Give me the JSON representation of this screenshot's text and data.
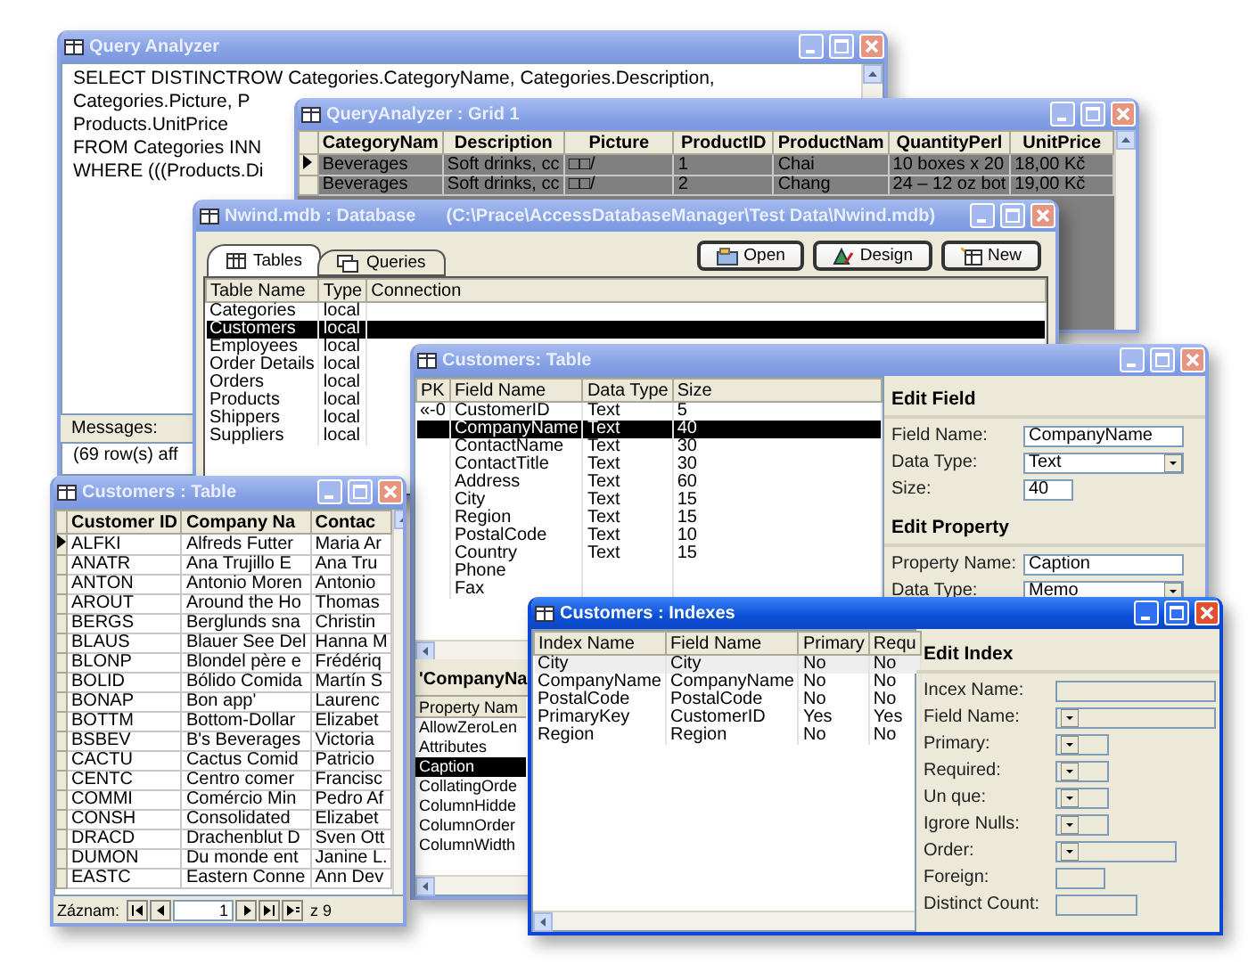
{
  "query_analyzer": {
    "title": "Query Analyzer",
    "active": false,
    "sql_lines": [
      "SELECT DISTINCTROW Categories.CategoryName, Categories.Description,",
      "Categories.Picture, P",
      "Products.UnitPrice",
      "FROM Categories INN",
      "WHERE (((Products.Di"
    ],
    "messages_label": "Messages:",
    "messages": [
      "(69 row(s) aff"
    ]
  },
  "grid": {
    "title": "QueryAnalyzer : Grid 1",
    "active": false,
    "columns": [
      "CategoryNam",
      "Description",
      "Picture",
      "ProductID",
      "ProductNam",
      "QuantityPerl",
      "UnitPrice"
    ],
    "rows": [
      {
        "current": true,
        "cells": [
          "Beverages",
          "Soft drinks, cc",
          "□□/",
          "1",
          "Chai",
          "10 boxes x 20",
          "18,00 Kč"
        ]
      },
      {
        "current": false,
        "cells": [
          "Beverages",
          "Soft drinks, cc",
          "□□/",
          "2",
          "Chang",
          "24 – 12 oz bot",
          "19,00 Kč"
        ]
      }
    ]
  },
  "database": {
    "title": "Nwind.mdb : Database",
    "path": "(C:\\Prace\\AccessDatabaseManager\\Test Data\\Nwind.mdb)",
    "active": false,
    "tabs": [
      {
        "label": "Tables",
        "kind": "tables",
        "selected": true
      },
      {
        "label": "Queries",
        "kind": "queries",
        "selected": false
      }
    ],
    "buttons": [
      {
        "label": "Open",
        "kind": "open"
      },
      {
        "label": "Design",
        "kind": "design"
      },
      {
        "label": "New",
        "kind": "new"
      }
    ],
    "columns": [
      "Table Name",
      "Type",
      "Connection"
    ],
    "rows": [
      {
        "selected": false,
        "cells": [
          "Categories",
          "local"
        ]
      },
      {
        "selected": true,
        "cells": [
          "Customers",
          "local"
        ]
      },
      {
        "selected": false,
        "cells": [
          "Employees",
          "local"
        ]
      },
      {
        "selected": false,
        "cells": [
          "Order Details",
          "local"
        ]
      },
      {
        "selected": false,
        "cells": [
          "Orders",
          "local"
        ]
      },
      {
        "selected": false,
        "cells": [
          "Products",
          "local"
        ]
      },
      {
        "selected": false,
        "cells": [
          "Shippers",
          "local"
        ]
      },
      {
        "selected": false,
        "cells": [
          "Suppliers",
          "local"
        ]
      }
    ]
  },
  "table_design": {
    "title": "Customers: Table",
    "active": false,
    "columns": [
      "PK",
      "Field Name",
      "Data Type",
      "Size"
    ],
    "fields": [
      {
        "selected": false,
        "cells": [
          "«-0",
          "CustomerID",
          "Text",
          "5"
        ]
      },
      {
        "selected": true,
        "cells": [
          "",
          "CompanyName",
          "Text",
          "40"
        ]
      },
      {
        "selected": false,
        "cells": [
          "",
          "ContactName",
          "Text",
          "30"
        ]
      },
      {
        "selected": false,
        "cells": [
          "",
          "ContactTitle",
          "Text",
          "30"
        ]
      },
      {
        "selected": false,
        "cells": [
          "",
          "Address",
          "Text",
          "60"
        ]
      },
      {
        "selected": false,
        "cells": [
          "",
          "City",
          "Text",
          "15"
        ]
      },
      {
        "selected": false,
        "cells": [
          "",
          "Region",
          "Text",
          "15"
        ]
      },
      {
        "selected": false,
        "cells": [
          "",
          "PostalCode",
          "Text",
          "10"
        ]
      },
      {
        "selected": false,
        "cells": [
          "",
          "Country",
          "Text",
          "15"
        ]
      },
      {
        "selected": false,
        "cells": [
          "",
          "Phone"
        ]
      },
      {
        "selected": false,
        "cells": [
          "",
          "Fax"
        ]
      }
    ],
    "property_pane": {
      "title": "'CompanyNa",
      "header": "Property Nam",
      "rows": [
        {
          "name": "AllowZeroLen",
          "selected": false
        },
        {
          "name": "Attributes",
          "selected": false
        },
        {
          "name": "Caption",
          "selected": true
        },
        {
          "name": "CollatingOrde",
          "selected": false
        },
        {
          "name": "ColumnHidde",
          "selected": false
        },
        {
          "name": "ColumnOrder",
          "selected": false
        },
        {
          "name": "ColumnWidth",
          "selected": false
        }
      ]
    },
    "edit_field": {
      "heading": "Edit Field",
      "rows": [
        {
          "label": "Field Name:",
          "value": "CompanyName",
          "kind": "text"
        },
        {
          "label": "Data Type:",
          "value": "Text",
          "kind": "dropdown"
        },
        {
          "label": "Size:",
          "value": "40",
          "kind": "small-text"
        }
      ]
    },
    "edit_property": {
      "heading": "Edit Property",
      "rows": [
        {
          "label": "Property Name:",
          "value": "Caption",
          "kind": "text"
        },
        {
          "label": "Data Type:",
          "value": "Memo",
          "kind": "dropdown"
        }
      ]
    }
  },
  "datasheet": {
    "title": "Customers : Table",
    "active": false,
    "columns": [
      "Customer ID",
      "Company Na",
      "Contac"
    ],
    "rows": [
      {
        "current": true,
        "cells": [
          "ALFKI",
          "Alfreds Futter",
          "Maria Ar"
        ]
      },
      {
        "current": false,
        "cells": [
          "ANATR",
          "Ana Trujillo E",
          "Ana Tru"
        ]
      },
      {
        "current": false,
        "cells": [
          "ANTON",
          "Antonio Moren",
          "Antonio"
        ]
      },
      {
        "current": false,
        "cells": [
          "AROUT",
          "Around the Ho",
          "Thomas"
        ]
      },
      {
        "current": false,
        "cells": [
          "BERGS",
          "Berglunds sna",
          "Christin"
        ]
      },
      {
        "current": false,
        "cells": [
          "BLAUS",
          "Blauer See Del",
          "Hanna M"
        ]
      },
      {
        "current": false,
        "cells": [
          "BLONP",
          "Blondel père e",
          "Frédériq"
        ]
      },
      {
        "current": false,
        "cells": [
          "BOLID",
          "Bólido Comida",
          "Martín S"
        ]
      },
      {
        "current": false,
        "cells": [
          "BONAP",
          "Bon app'",
          "Laurenc"
        ]
      },
      {
        "current": false,
        "cells": [
          "BOTTM",
          "Bottom-Dollar",
          "Elizabet"
        ]
      },
      {
        "current": false,
        "cells": [
          "BSBEV",
          "B's Beverages",
          "Victoria"
        ]
      },
      {
        "current": false,
        "cells": [
          "CACTU",
          "Cactus Comid",
          "Patricio"
        ]
      },
      {
        "current": false,
        "cells": [
          "CENTC",
          "Centro comer",
          "Francisc"
        ]
      },
      {
        "current": false,
        "cells": [
          "COMMI",
          "Comércio Min",
          "Pedro Af"
        ]
      },
      {
        "current": false,
        "cells": [
          "CONSH",
          "Consolidated",
          "Elizabet"
        ]
      },
      {
        "current": false,
        "cells": [
          "DRACD",
          "Drachenblut D",
          "Sven Ott"
        ]
      },
      {
        "current": false,
        "cells": [
          "DUMON",
          "Du monde ent",
          "Janine L."
        ]
      },
      {
        "current": false,
        "cells": [
          "EASTC",
          "Eastern Conne",
          "Ann Dev"
        ]
      }
    ],
    "nav": {
      "label": "Záznam:",
      "record": "1",
      "count": "z 9"
    }
  },
  "indexes": {
    "title": "Customers : Indexes",
    "active": true,
    "columns": [
      "Index Name",
      "Field Name",
      "Primary",
      "Requ"
    ],
    "rows": [
      {
        "selected": true,
        "cells": [
          "City",
          "City",
          "No",
          "No"
        ]
      },
      {
        "selected": false,
        "cells": [
          "CompanyName",
          "CompanyName",
          "No",
          "No"
        ]
      },
      {
        "selected": false,
        "cells": [
          "PostalCode",
          "PostalCode",
          "No",
          "No"
        ]
      },
      {
        "selected": false,
        "cells": [
          "PrimaryKey",
          "CustomerID",
          "Yes",
          "Yes"
        ]
      },
      {
        "selected": false,
        "cells": [
          "Region",
          "Region",
          "No",
          "No"
        ]
      }
    ],
    "edit_index": {
      "heading": "Edit Index",
      "rows": [
        {
          "label": "Incex Name:",
          "kind": "text"
        },
        {
          "label": "Field Name:",
          "kind": "dropdown"
        },
        {
          "label": "Primary:",
          "kind": "small-dropdown"
        },
        {
          "label": "Required:",
          "kind": "small-dropdown"
        },
        {
          "label": "Un que:",
          "kind": "small-dropdown"
        },
        {
          "label": "Igrore Nulls:",
          "kind": "small-dropdown"
        },
        {
          "label": "Order:",
          "kind": "medium-dropdown"
        },
        {
          "label": "Foreign:",
          "kind": "small-text"
        },
        {
          "label": "Distinct Count:",
          "kind": "medium-text"
        }
      ]
    }
  }
}
